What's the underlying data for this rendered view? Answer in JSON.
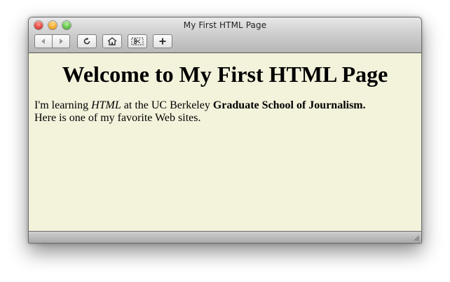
{
  "window": {
    "title": "My First HTML Page"
  },
  "toolbar": {
    "buttons": [
      {
        "name": "back",
        "icon": "chevron-left-icon"
      },
      {
        "name": "forward",
        "icon": "chevron-right-icon"
      },
      {
        "name": "reload",
        "icon": "reload-icon"
      },
      {
        "name": "home",
        "icon": "home-icon"
      },
      {
        "name": "snip",
        "icon": "scissors-icon"
      },
      {
        "name": "add",
        "icon": "plus-icon"
      }
    ]
  },
  "page": {
    "heading": "Welcome to My First HTML Page",
    "line1_prefix": "I'm learning ",
    "line1_em": "HTML",
    "line1_mid": " at the UC Berkeley ",
    "line1_bold": "Graduate School of Journalism.",
    "line2": "Here is one of my favorite Web sites."
  },
  "colors": {
    "page_background": "#f3f2db",
    "close": "#e0443a",
    "minimize": "#f4a92a",
    "zoom": "#5fc246"
  }
}
